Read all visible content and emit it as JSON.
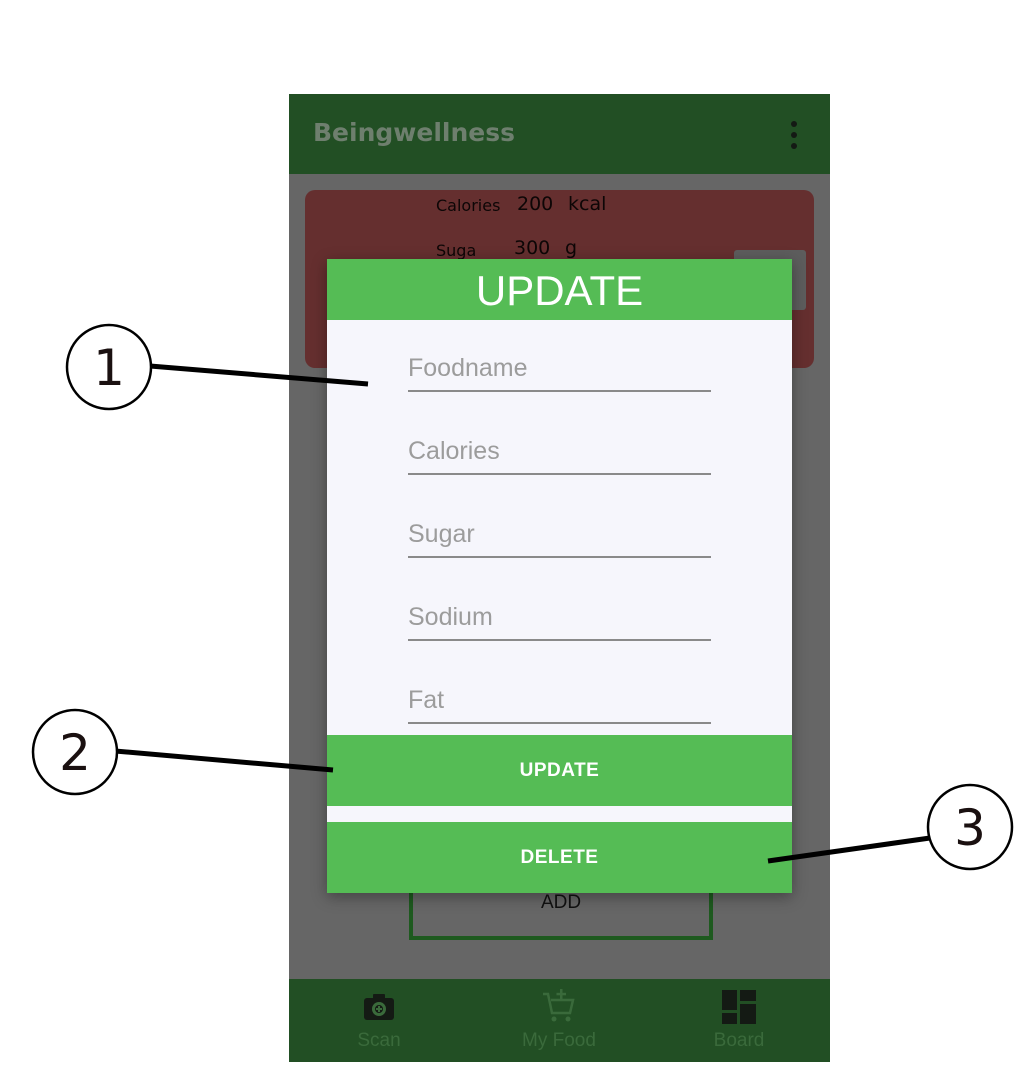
{
  "app": {
    "title": "Beingwellness",
    "menu_icon": "more-vert-icon"
  },
  "food_card": {
    "calories_label": "Calories",
    "calories_value": "200",
    "calories_unit": "kcal",
    "sugar_label": "Suga",
    "sugar_value": "300",
    "sugar_unit": "g"
  },
  "background": {
    "add_label": "ADD"
  },
  "dialog": {
    "title": "UPDATE",
    "fields": {
      "foodname_placeholder": "Foodname",
      "calories_placeholder": "Calories",
      "sugar_placeholder": "Sugar",
      "sodium_placeholder": "Sodium",
      "fat_placeholder": "Fat"
    },
    "update_label": "UPDATE",
    "delete_label": "DELETE"
  },
  "bottom_nav": {
    "items": [
      {
        "label": "Scan",
        "icon": "camera-icon"
      },
      {
        "label": "My Food",
        "icon": "cart-add-icon"
      },
      {
        "label": "Board",
        "icon": "dashboard-icon"
      }
    ]
  },
  "callouts": [
    "1",
    "2",
    "3"
  ],
  "colors": {
    "app_bar": "#224f24",
    "dialog_green": "#55bc55",
    "card_red": "#652f2f",
    "overlay": "#666666"
  }
}
